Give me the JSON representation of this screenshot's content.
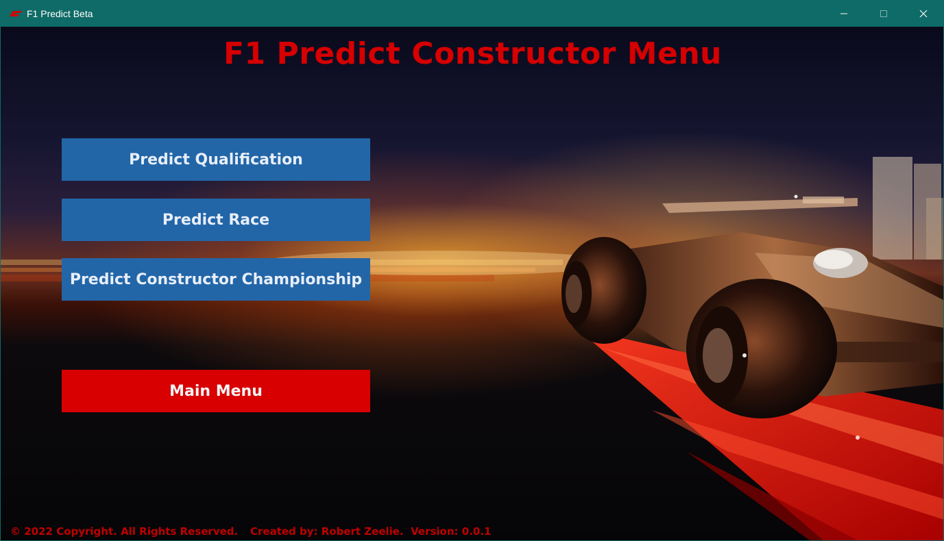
{
  "window": {
    "title": "F1 Predict Beta",
    "controls": [
      "minimize-icon",
      "maximize-icon",
      "close-icon"
    ],
    "accent_color": "#0f6b67"
  },
  "page": {
    "heading": "F1 Predict Constructor Menu",
    "heading_color": "#d60000"
  },
  "menu": {
    "predict_qualification": "Predict Qualification",
    "predict_race": "Predict Race",
    "predict_constructor_championship": "Predict Constructor Championship",
    "main_menu": "Main Menu",
    "button_color": "#2266a8",
    "main_menu_color": "#d80000"
  },
  "footer": {
    "copyright": "© 2022 Copyright. All Rights Reserved.",
    "credits": "Created by: Robert Zeelie.  Version: 0.0.1"
  },
  "background": {
    "subject": "F1 race car on red track with city skyline at dusk"
  }
}
